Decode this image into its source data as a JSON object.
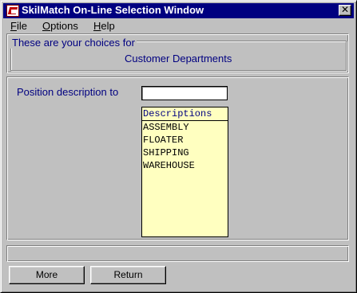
{
  "window": {
    "title": "SkilMatch On-Line Selection Window",
    "close_glyph": "✕"
  },
  "menu": {
    "items": [
      {
        "mnemonic": "F",
        "rest": "ile"
      },
      {
        "mnemonic": "O",
        "rest": "ptions"
      },
      {
        "mnemonic": "H",
        "rest": "elp"
      }
    ]
  },
  "choices": {
    "legend": "These are your choices for",
    "subject": "Customer Departments"
  },
  "position": {
    "label": "Position description to",
    "value": ""
  },
  "list": {
    "header": "Descriptions",
    "items": [
      "ASSEMBLY",
      "FLOATER",
      "SHIPPING",
      "WAREHOUSE"
    ]
  },
  "status": {
    "text": ""
  },
  "buttons": {
    "more": "More",
    "return": "Return"
  },
  "colors": {
    "titlebar": "#000080",
    "label_text": "#000080",
    "list_background": "#ffffc0",
    "window_face": "#c0c0c0"
  },
  "icons": {
    "app": "skilmatch-app-icon",
    "close": "close-icon"
  }
}
